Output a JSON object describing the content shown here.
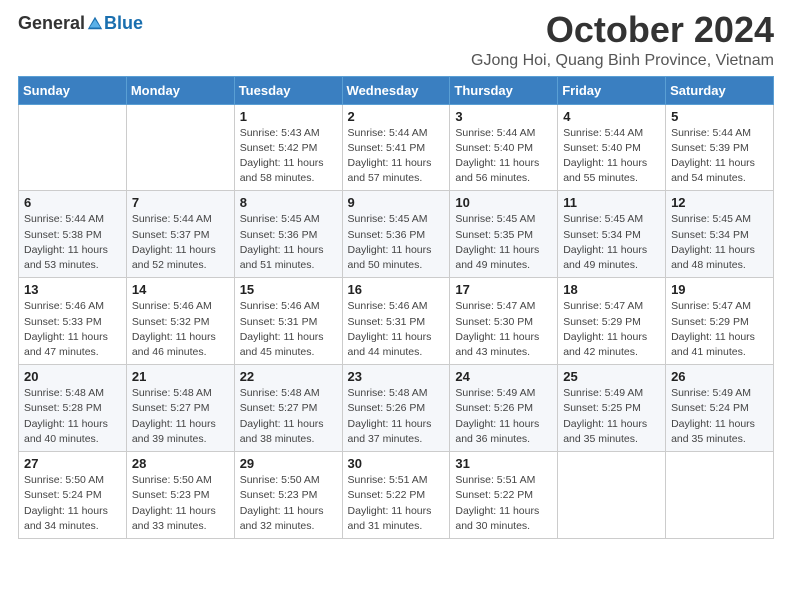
{
  "logo": {
    "general": "General",
    "blue": "Blue"
  },
  "title": "October 2024",
  "subtitle": "GJong Hoi, Quang Binh Province, Vietnam",
  "days_of_week": [
    "Sunday",
    "Monday",
    "Tuesday",
    "Wednesday",
    "Thursday",
    "Friday",
    "Saturday"
  ],
  "weeks": [
    [
      {
        "day": "",
        "info": ""
      },
      {
        "day": "",
        "info": ""
      },
      {
        "day": "1",
        "info": "Sunrise: 5:43 AM\nSunset: 5:42 PM\nDaylight: 11 hours and 58 minutes."
      },
      {
        "day": "2",
        "info": "Sunrise: 5:44 AM\nSunset: 5:41 PM\nDaylight: 11 hours and 57 minutes."
      },
      {
        "day": "3",
        "info": "Sunrise: 5:44 AM\nSunset: 5:40 PM\nDaylight: 11 hours and 56 minutes."
      },
      {
        "day": "4",
        "info": "Sunrise: 5:44 AM\nSunset: 5:40 PM\nDaylight: 11 hours and 55 minutes."
      },
      {
        "day": "5",
        "info": "Sunrise: 5:44 AM\nSunset: 5:39 PM\nDaylight: 11 hours and 54 minutes."
      }
    ],
    [
      {
        "day": "6",
        "info": "Sunrise: 5:44 AM\nSunset: 5:38 PM\nDaylight: 11 hours and 53 minutes."
      },
      {
        "day": "7",
        "info": "Sunrise: 5:44 AM\nSunset: 5:37 PM\nDaylight: 11 hours and 52 minutes."
      },
      {
        "day": "8",
        "info": "Sunrise: 5:45 AM\nSunset: 5:36 PM\nDaylight: 11 hours and 51 minutes."
      },
      {
        "day": "9",
        "info": "Sunrise: 5:45 AM\nSunset: 5:36 PM\nDaylight: 11 hours and 50 minutes."
      },
      {
        "day": "10",
        "info": "Sunrise: 5:45 AM\nSunset: 5:35 PM\nDaylight: 11 hours and 49 minutes."
      },
      {
        "day": "11",
        "info": "Sunrise: 5:45 AM\nSunset: 5:34 PM\nDaylight: 11 hours and 49 minutes."
      },
      {
        "day": "12",
        "info": "Sunrise: 5:45 AM\nSunset: 5:34 PM\nDaylight: 11 hours and 48 minutes."
      }
    ],
    [
      {
        "day": "13",
        "info": "Sunrise: 5:46 AM\nSunset: 5:33 PM\nDaylight: 11 hours and 47 minutes."
      },
      {
        "day": "14",
        "info": "Sunrise: 5:46 AM\nSunset: 5:32 PM\nDaylight: 11 hours and 46 minutes."
      },
      {
        "day": "15",
        "info": "Sunrise: 5:46 AM\nSunset: 5:31 PM\nDaylight: 11 hours and 45 minutes."
      },
      {
        "day": "16",
        "info": "Sunrise: 5:46 AM\nSunset: 5:31 PM\nDaylight: 11 hours and 44 minutes."
      },
      {
        "day": "17",
        "info": "Sunrise: 5:47 AM\nSunset: 5:30 PM\nDaylight: 11 hours and 43 minutes."
      },
      {
        "day": "18",
        "info": "Sunrise: 5:47 AM\nSunset: 5:29 PM\nDaylight: 11 hours and 42 minutes."
      },
      {
        "day": "19",
        "info": "Sunrise: 5:47 AM\nSunset: 5:29 PM\nDaylight: 11 hours and 41 minutes."
      }
    ],
    [
      {
        "day": "20",
        "info": "Sunrise: 5:48 AM\nSunset: 5:28 PM\nDaylight: 11 hours and 40 minutes."
      },
      {
        "day": "21",
        "info": "Sunrise: 5:48 AM\nSunset: 5:27 PM\nDaylight: 11 hours and 39 minutes."
      },
      {
        "day": "22",
        "info": "Sunrise: 5:48 AM\nSunset: 5:27 PM\nDaylight: 11 hours and 38 minutes."
      },
      {
        "day": "23",
        "info": "Sunrise: 5:48 AM\nSunset: 5:26 PM\nDaylight: 11 hours and 37 minutes."
      },
      {
        "day": "24",
        "info": "Sunrise: 5:49 AM\nSunset: 5:26 PM\nDaylight: 11 hours and 36 minutes."
      },
      {
        "day": "25",
        "info": "Sunrise: 5:49 AM\nSunset: 5:25 PM\nDaylight: 11 hours and 35 minutes."
      },
      {
        "day": "26",
        "info": "Sunrise: 5:49 AM\nSunset: 5:24 PM\nDaylight: 11 hours and 35 minutes."
      }
    ],
    [
      {
        "day": "27",
        "info": "Sunrise: 5:50 AM\nSunset: 5:24 PM\nDaylight: 11 hours and 34 minutes."
      },
      {
        "day": "28",
        "info": "Sunrise: 5:50 AM\nSunset: 5:23 PM\nDaylight: 11 hours and 33 minutes."
      },
      {
        "day": "29",
        "info": "Sunrise: 5:50 AM\nSunset: 5:23 PM\nDaylight: 11 hours and 32 minutes."
      },
      {
        "day": "30",
        "info": "Sunrise: 5:51 AM\nSunset: 5:22 PM\nDaylight: 11 hours and 31 minutes."
      },
      {
        "day": "31",
        "info": "Sunrise: 5:51 AM\nSunset: 5:22 PM\nDaylight: 11 hours and 30 minutes."
      },
      {
        "day": "",
        "info": ""
      },
      {
        "day": "",
        "info": ""
      }
    ]
  ]
}
